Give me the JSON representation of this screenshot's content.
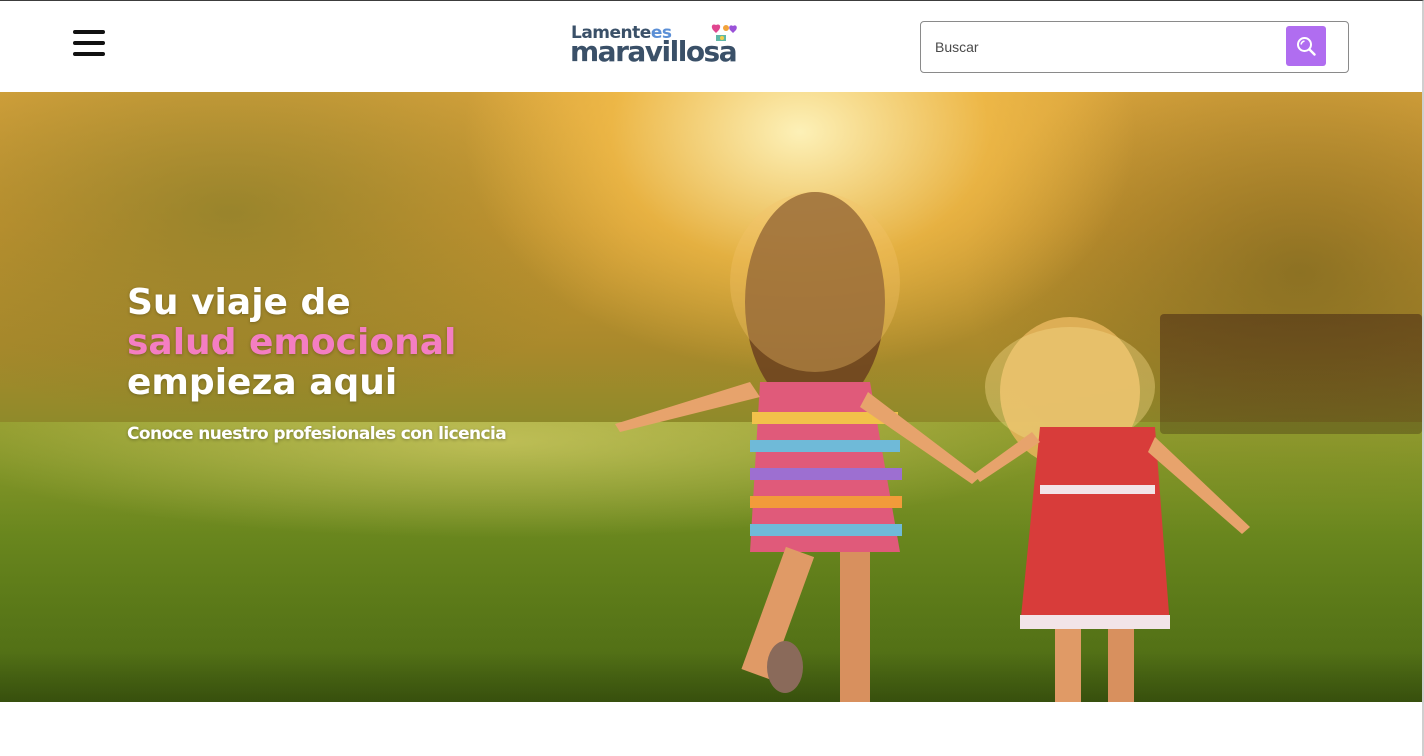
{
  "header": {
    "menu_icon": "hamburger-menu-icon",
    "logo": {
      "text_top": "Lamente",
      "text_top_es": "es",
      "text_bottom": "maravillosa"
    },
    "search": {
      "placeholder": "Buscar",
      "button_icon": "search-icon"
    }
  },
  "hero": {
    "title_line1": "Su viaje de",
    "title_line2": "salud emocional",
    "title_line3": "empieza aqui",
    "subtitle": "Conoce nuestro profesionales con licencia",
    "image": "children-running-in-field-photo"
  },
  "colors": {
    "accent_purple": "#b06df0",
    "accent_pink": "#f47ec2",
    "logo_navy": "#3a5068"
  }
}
